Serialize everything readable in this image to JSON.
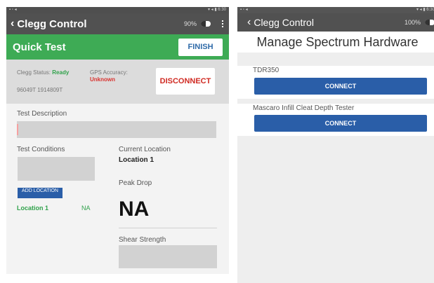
{
  "left": {
    "status_bar": {
      "left": "▪ ▫ ◂",
      "right": "▾ ◂ ▮ 6:30"
    },
    "app_title": "Clegg Control",
    "battery": "90%",
    "header": {
      "title": "Quick Test",
      "finish_label": "FINISH"
    },
    "status": {
      "clegg_label": "Clegg Status:",
      "clegg_value": "Ready",
      "serial": "96049T 1914809T",
      "gps_label": "GPS Accuracy:",
      "gps_value": "Unknown",
      "disconnect_label": "DISCONNECT"
    },
    "test_description_label": "Test Description",
    "test_conditions_label": "Test Conditions",
    "add_button_label": "ADD LOCATION",
    "location_row": {
      "name": "Location 1",
      "value": "NA"
    },
    "current_location_label": "Current Location",
    "current_location_value": "Location 1",
    "peak_drop_label": "Peak Drop",
    "peak_drop_value": "NA",
    "shear_strength_label": "Shear Strength"
  },
  "right": {
    "status_bar": {
      "left": "▪ ▫ ◂",
      "right": "▾ ◂ ▮ 6:30"
    },
    "app_title": "Clegg Control",
    "battery": "100%",
    "page_title": "Manage Spectrum Hardware",
    "devices": [
      {
        "name": "TDR350",
        "button": "CONNECT"
      },
      {
        "name": "Mascaro Infill Cleat Depth Tester",
        "button": "CONNECT"
      }
    ]
  },
  "colors": {
    "green": "#3eab55",
    "blue": "#2a5ea8",
    "red": "#d02a22",
    "appbar": "#515151"
  }
}
